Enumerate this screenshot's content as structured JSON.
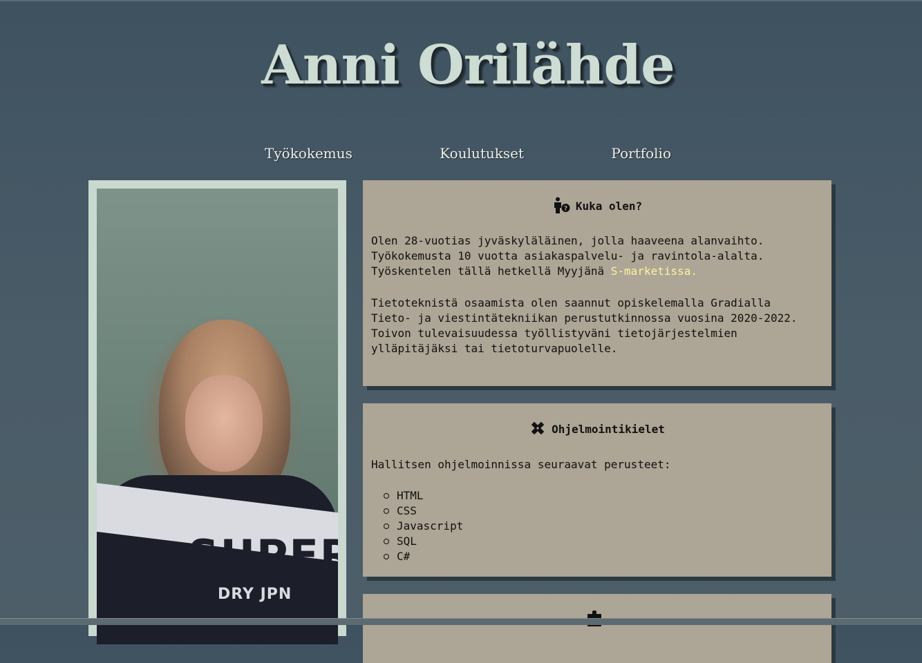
{
  "header": {
    "title": "Anni Orilähde"
  },
  "nav": {
    "items": [
      {
        "label": "Työkokemus"
      },
      {
        "label": "Koulutukset"
      },
      {
        "label": "Portfolio"
      }
    ]
  },
  "photo": {
    "shirt_text": "SUPER",
    "shirt_sub": "DRY JPN"
  },
  "about": {
    "icon": "person-question-icon",
    "title": "Kuka olen?",
    "line1": "Olen 28-vuotias jyväskyläläinen, jolla haaveena alanvaihto.",
    "line2": "Työkokemusta 10 vuotta asiakaspalvelu- ja ravintola-alalta.",
    "line3_prefix": "Työskentelen tällä hetkellä Myyjänä ",
    "line3_highlight": "S-marketissa.",
    "line4": "Tietoteknistä osaamista olen saannut opiskelemalla Gradialla",
    "line5": "Tieto- ja viestintätekniikan perustutkinnossa vuosina 2020-2022.",
    "line6": "Toivon tulevaisuudessa työllistyväni tietojärjestelmien",
    "line7": "ylläpitäjäksi tai tietoturvapuolelle."
  },
  "languages": {
    "icon": "pencil-ruler-icon",
    "title": "Ohjelmointikielet",
    "intro": "Hallitsen ohjelmoinnissa seuraavat perusteet:",
    "items": [
      "HTML",
      "CSS",
      "Javascript",
      "SQL",
      "C#"
    ]
  },
  "third_card": {
    "icon": "puzzle-icon"
  },
  "colors": {
    "background": "#455864",
    "title": "#cdddd4",
    "card": "#ada595",
    "highlight": "#fdf3a0",
    "photo_frame": "#c9d9d0"
  }
}
